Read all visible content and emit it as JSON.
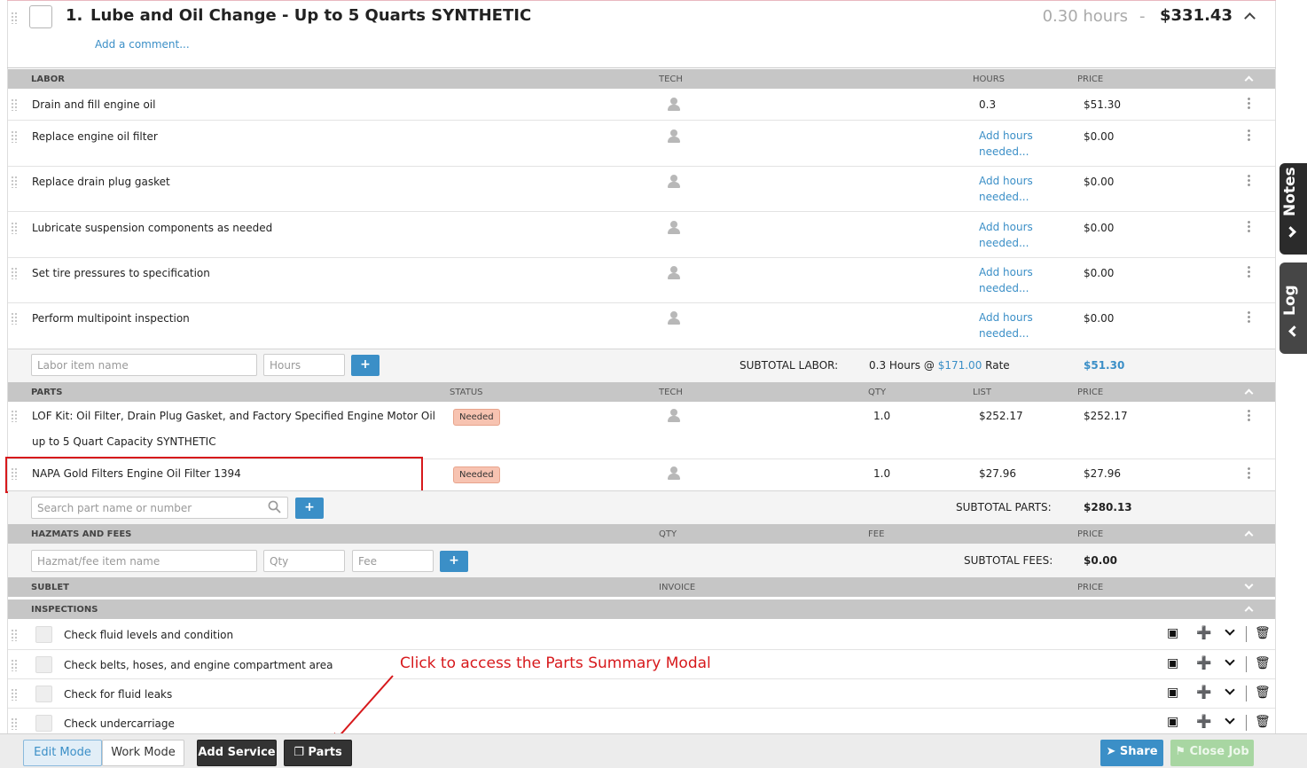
{
  "service": {
    "number": "1.",
    "title": "Lube and Oil Change - Up to 5 Quarts SYNTHETIC",
    "hours": "0.30 hours",
    "separator": "-",
    "total": "$331.43",
    "add_comment": "Add a comment..."
  },
  "labor": {
    "header": {
      "name": "LABOR",
      "tech": "TECH",
      "hours": "HOURS",
      "price": "PRICE"
    },
    "rows": [
      {
        "name": "Drain and fill engine oil",
        "hours": "0.3",
        "price": "$51.30"
      },
      {
        "name": "Replace engine oil filter",
        "hours": "Add hours needed...",
        "price": "$0.00"
      },
      {
        "name": "Replace drain plug gasket",
        "hours": "Add hours needed...",
        "price": "$0.00"
      },
      {
        "name": "Lubricate suspension components as needed",
        "hours": "Add hours needed...",
        "price": "$0.00"
      },
      {
        "name": "Set tire pressures to specification",
        "hours": "Add hours needed...",
        "price": "$0.00"
      },
      {
        "name": "Perform multipoint inspection",
        "hours": "Add hours needed...",
        "price": "$0.00"
      }
    ],
    "name_placeholder": "Labor item name",
    "hours_placeholder": "Hours",
    "add_label": "+",
    "subtotal_label": "SUBTOTAL LABOR:",
    "subtotal_hours": "0.3 Hours @",
    "rate_value": "$171.00",
    "rate_label": "Rate",
    "subtotal_value": "$51.30"
  },
  "parts": {
    "header": {
      "name": "PARTS",
      "status": "STATUS",
      "tech": "TECH",
      "qty": "QTY",
      "list": "LIST",
      "price": "PRICE"
    },
    "rows": [
      {
        "name_line1": "LOF Kit: Oil Filter, Drain Plug Gasket, and Factory Specified Engine Motor Oil",
        "name_line2": "up to 5 Quart Capacity SYNTHETIC",
        "status": "Needed",
        "qty": "1.0",
        "list": "$252.17",
        "price": "$252.17"
      },
      {
        "name_line1": "NAPA Gold Filters Engine Oil Filter 1394",
        "status": "Needed",
        "qty": "1.0",
        "list": "$27.96",
        "price": "$27.96"
      }
    ],
    "search_placeholder": "Search part name or number",
    "add_label": "+",
    "subtotal_label": "SUBTOTAL PARTS:",
    "subtotal_value": "$280.13"
  },
  "hazmat": {
    "header": {
      "name": "HAZMATS AND FEES",
      "qty": "QTY",
      "fee": "FEE",
      "price": "PRICE"
    },
    "name_placeholder": "Hazmat/fee item name",
    "qty_placeholder": "Qty",
    "fee_placeholder": "Fee",
    "add_label": "+",
    "subtotal_label": "SUBTOTAL FEES:",
    "subtotal_value": "$0.00"
  },
  "sublet": {
    "header": {
      "name": "SUBLET",
      "invoice": "INVOICE",
      "price": "PRICE"
    }
  },
  "inspections": {
    "header": "INSPECTIONS",
    "rows": [
      "Check fluid levels and condition",
      "Check belts, hoses, and engine compartment area",
      "Check for fluid leaks",
      "Check undercarriage"
    ]
  },
  "annotation": "Click to access the Parts Summary Modal",
  "side_tabs": {
    "notes": "Notes",
    "log": "Log"
  },
  "footer": {
    "edit_mode": "Edit Mode",
    "work_mode": "Work Mode",
    "add_service": "Add Service",
    "parts": "Parts",
    "share": "Share",
    "close_job": "Close Job"
  },
  "colors": {
    "accent": "#3b8fc7",
    "needed_badge": "#f7c3b1",
    "annotation_red": "#d7191c",
    "close_green": "#a8d6a2"
  }
}
